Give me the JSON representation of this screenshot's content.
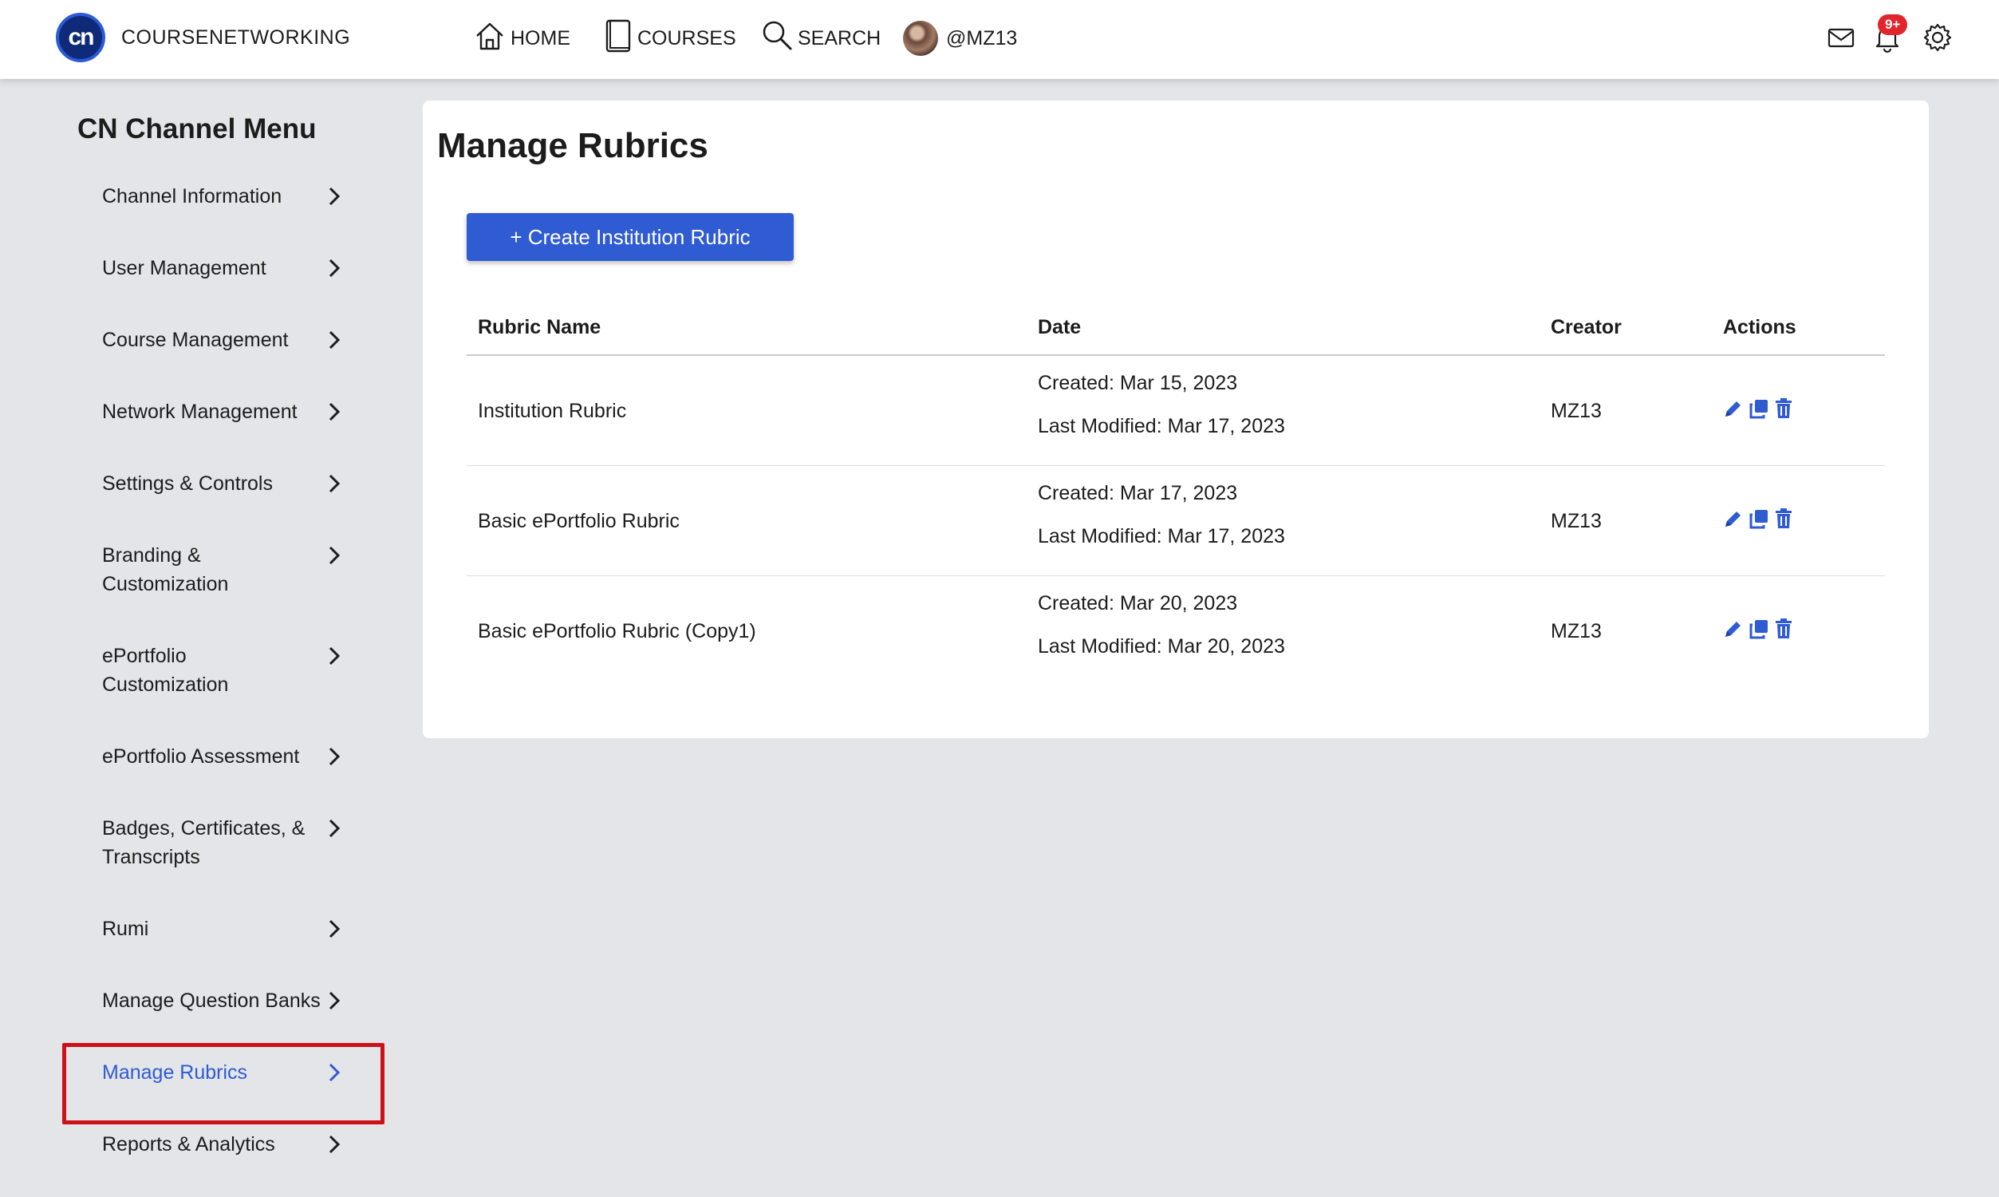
{
  "header": {
    "logo_text": "cn",
    "brand": "COURSENETWORKING",
    "nav": {
      "home": "HOME",
      "courses": "COURSES",
      "search": "SEARCH",
      "user": "@MZ13"
    },
    "notification_badge": "9+"
  },
  "sidebar": {
    "title": "CN Channel Menu",
    "items": [
      {
        "label": "Channel Information"
      },
      {
        "label": "User Management"
      },
      {
        "label": "Course Management"
      },
      {
        "label": "Network Management"
      },
      {
        "label": "Settings & Controls"
      },
      {
        "label": "Branding & Customization"
      },
      {
        "label": "ePortfolio Customization"
      },
      {
        "label": "ePortfolio Assessment"
      },
      {
        "label": "Badges, Certificates, & Transcripts"
      },
      {
        "label": "Rumi"
      },
      {
        "label": "Manage Question Banks"
      },
      {
        "label": "Manage Rubrics",
        "active": true
      },
      {
        "label": "Reports & Analytics"
      }
    ]
  },
  "main": {
    "title": "Manage Rubrics",
    "create_button": "+ Create Institution Rubric",
    "columns": {
      "name": "Rubric Name",
      "date": "Date",
      "creator": "Creator",
      "actions": "Actions"
    },
    "rows": [
      {
        "name": "Institution Rubric",
        "created": "Created: Mar 15, 2023",
        "modified": "Last Modified: Mar 17, 2023",
        "creator": "MZ13"
      },
      {
        "name": "Basic ePortfolio Rubric",
        "created": "Created: Mar 17, 2023",
        "modified": "Last Modified: Mar 17, 2023",
        "creator": "MZ13"
      },
      {
        "name": "Basic ePortfolio Rubric (Copy1)",
        "created": "Created: Mar 20, 2023",
        "modified": "Last Modified: Mar 20, 2023",
        "creator": "MZ13"
      }
    ]
  },
  "colors": {
    "accent": "#2f5bd3",
    "highlight_frame": "#cc1118",
    "badge": "#e0262c",
    "background": "#e3e5e9"
  },
  "icons": [
    "home-icon",
    "book-icon",
    "search-icon",
    "mail-icon",
    "bell-icon",
    "gear-icon",
    "chevron-right-icon",
    "pencil-icon",
    "copy-icon",
    "trash-icon"
  ]
}
